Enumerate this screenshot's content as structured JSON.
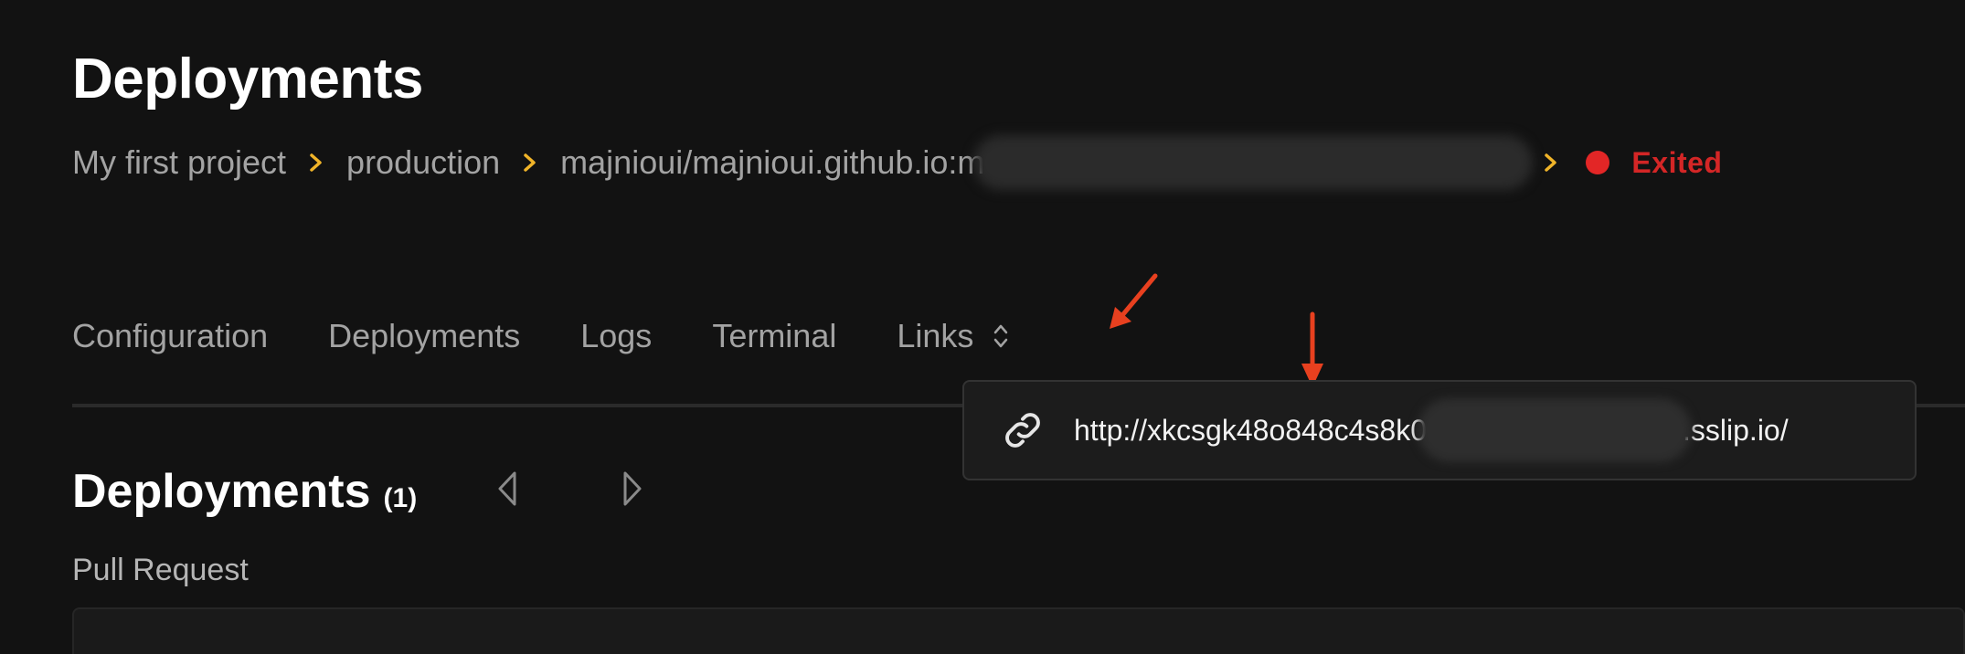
{
  "page": {
    "title": "Deployments"
  },
  "breadcrumb": {
    "items": [
      "My first project",
      "production",
      "majnioui/majnioui.github.io:m"
    ],
    "status": "Exited",
    "status_color": "#e32626",
    "chevron_color": "#f0b429"
  },
  "tabs": [
    {
      "label": "Configuration"
    },
    {
      "label": "Deployments"
    },
    {
      "label": "Logs"
    },
    {
      "label": "Terminal"
    },
    {
      "label": "Links"
    }
  ],
  "links_dropdown": {
    "url_start": "http://xkcsgk48o848c4s8k0",
    "url_end": ".sslip.io/",
    "icon": "link-icon"
  },
  "deployments_section": {
    "title": "Deployments",
    "count": "(1)",
    "prev_icon": "caret-left-icon",
    "next_icon": "caret-right-icon"
  },
  "form": {
    "pull_request_label": "Pull Request"
  },
  "annotations": {
    "arrow_color": "#e8401f"
  }
}
